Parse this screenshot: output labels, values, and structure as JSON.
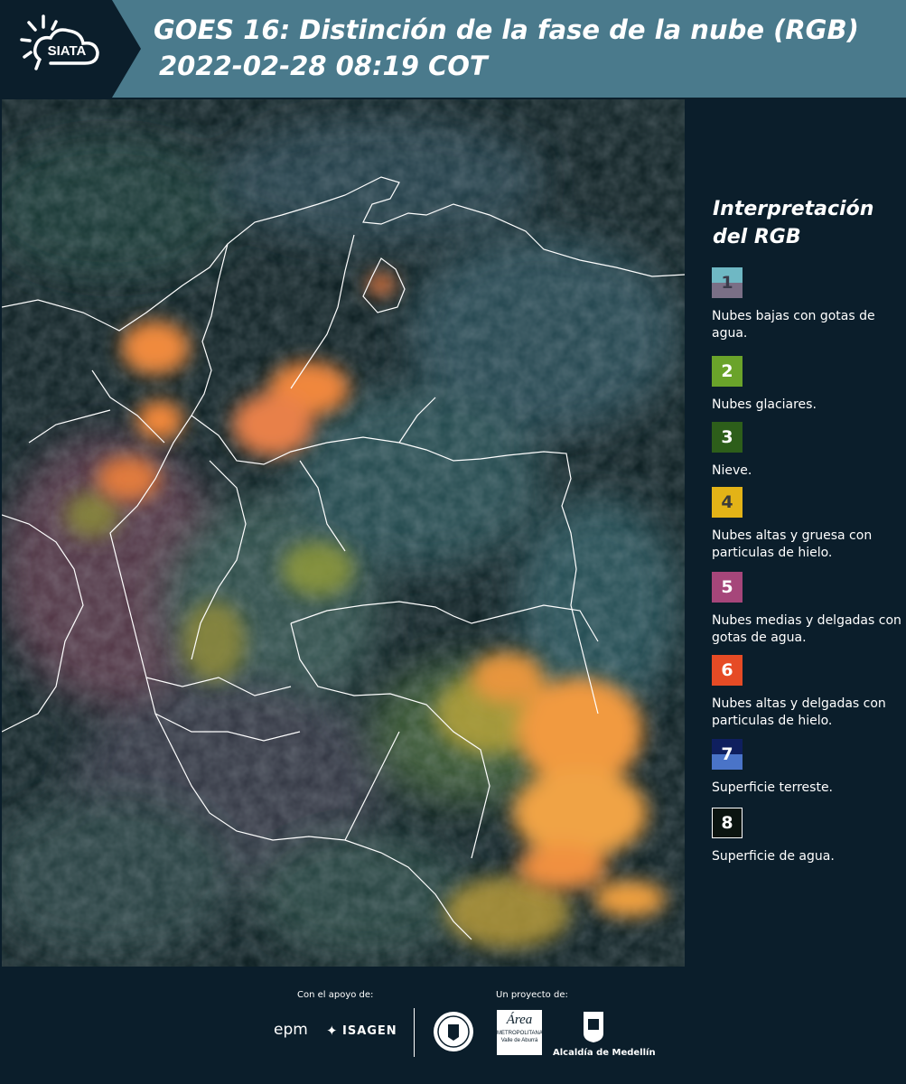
{
  "header": {
    "logo_text": "SIATA",
    "title_line1": "GOES 16: Distinción de la fase de la nube (RGB)",
    "title_line2": "2022-02-28 08:19 COT"
  },
  "legend": {
    "title": "Interpretación del RGB",
    "items": [
      {
        "number": "1",
        "label": "Nubes bajas con gotas de agua.",
        "color_top": "#6fb8c4",
        "color_bottom": "#7a6f86",
        "num_color": "#3a3a4a"
      },
      {
        "number": "2",
        "label": "Nubes glaciares.",
        "color_top": "#6aa32a",
        "color_bottom": "#6aa32a",
        "num_color": "#ffffff"
      },
      {
        "number": "3",
        "label": "Nieve.",
        "color_top": "#2d5e1a",
        "color_bottom": "#2d5e1a",
        "num_color": "#ffffff"
      },
      {
        "number": "4",
        "label": "Nubes altas y gruesa con particulas de hielo.",
        "color_top": "#e3b317",
        "color_bottom": "#e3b317",
        "num_color": "#3a3a3a"
      },
      {
        "number": "5",
        "label": "Nubes medias y delgadas con gotas de agua.",
        "color_top": "#a6467a",
        "color_bottom": "#a6467a",
        "num_color": "#ffffff"
      },
      {
        "number": "6",
        "label": "Nubes altas y delgadas con particulas de hielo.",
        "color_top": "#e64b25",
        "color_bottom": "#e64b25",
        "num_color": "#ffffff"
      },
      {
        "number": "7",
        "label": "Superficie terreste.",
        "color_top": "#0f1f5e",
        "color_bottom": "#4a74c8",
        "num_color": "#ffffff"
      },
      {
        "number": "8",
        "label": "Superficie de agua.",
        "color_top": "#0b1410",
        "color_bottom": "#0b1410",
        "num_color": "#ffffff"
      }
    ]
  },
  "footer": {
    "support_caption": "Con el apoyo de:",
    "project_caption": "Un proyecto de:",
    "brand_epm": "epm",
    "brand_isagen": "ISAGEN",
    "brand_area_line1": "Área",
    "brand_area_line2": "METROPOLITANA",
    "brand_area_line3": "Valle de Aburrá",
    "brand_alcaldia": "Alcaldía de Medellín"
  },
  "colors": {
    "header_bg": "#4a7a8c",
    "logo_bg": "#0b1e2b",
    "page_bg": "#0b1e2b",
    "border_lines": "#ffffff"
  }
}
